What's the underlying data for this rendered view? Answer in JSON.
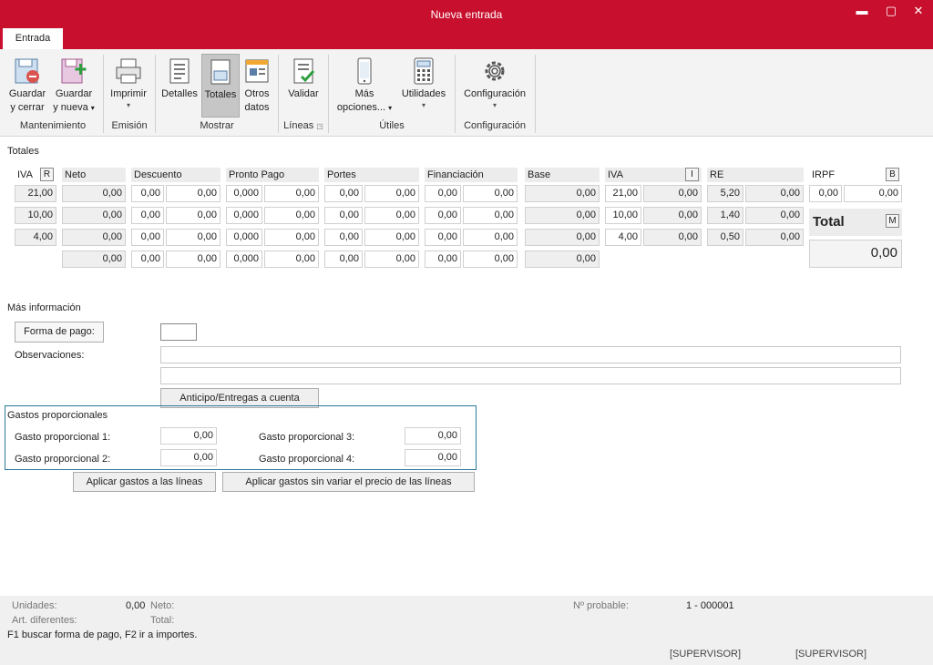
{
  "window": {
    "title": "Nueva entrada",
    "minimize": "▬",
    "maximize": "▢",
    "close": "✕",
    "tab": "Entrada"
  },
  "ribbon": {
    "guardar_cerrar": [
      "Guardar",
      "y cerrar"
    ],
    "guardar_nueva": [
      "Guardar",
      "y nueva"
    ],
    "imprimir": "Imprimir",
    "detalles": "Detalles",
    "totales": "Totales",
    "otros_datos": [
      "Otros",
      "datos"
    ],
    "validar": "Validar",
    "mas_opciones": [
      "Más",
      "opciones..."
    ],
    "utilidades": "Utilidades",
    "configuracion": "Configuración",
    "groups": {
      "mantenimiento": "Mantenimiento",
      "emision": "Emisión",
      "mostrar": "Mostrar",
      "lineas": "Líneas",
      "utiles": "Útiles",
      "configuracion": "Configuración"
    }
  },
  "totales": {
    "section_title": "Totales",
    "headers": {
      "iva": "IVA",
      "iva_badge": "R",
      "neto": "Neto",
      "descuento": "Descuento",
      "pronto_pago": "Pronto Pago",
      "portes": "Portes",
      "financiacion": "Financiación",
      "base": "Base",
      "iva2": "IVA",
      "iva2_badge": "I",
      "re": "RE",
      "irpf": "IRPF",
      "irpf_badge": "B"
    },
    "rows": [
      {
        "iva": "21,00",
        "neto": "0,00",
        "desc_pct": "0,00",
        "desc": "0,00",
        "pp_pct": "0,000",
        "pp": "0,00",
        "portes_pct": "0,00",
        "portes": "0,00",
        "fin_pct": "0,00",
        "fin": "0,00",
        "base": "0,00",
        "iva2_pct": "21,00",
        "iva2": "0,00",
        "re_pct": "5,20",
        "re": "0,00"
      },
      {
        "iva": "10,00",
        "neto": "0,00",
        "desc_pct": "0,00",
        "desc": "0,00",
        "pp_pct": "0,000",
        "pp": "0,00",
        "portes_pct": "0,00",
        "portes": "0,00",
        "fin_pct": "0,00",
        "fin": "0,00",
        "base": "0,00",
        "iva2_pct": "10,00",
        "iva2": "0,00",
        "re_pct": "1,40",
        "re": "0,00"
      },
      {
        "iva": "4,00",
        "neto": "0,00",
        "desc_pct": "0,00",
        "desc": "0,00",
        "pp_pct": "0,000",
        "pp": "0,00",
        "portes_pct": "0,00",
        "portes": "0,00",
        "fin_pct": "0,00",
        "fin": "0,00",
        "base": "0,00",
        "iva2_pct": "4,00",
        "iva2": "0,00",
        "re_pct": "0,50",
        "re": "0,00"
      }
    ],
    "totals_row": {
      "neto": "0,00",
      "desc_pct": "0,00",
      "desc": "0,00",
      "pp_pct": "0,000",
      "pp": "0,00",
      "portes_pct": "0,00",
      "portes": "0,00",
      "fin_pct": "0,00",
      "fin": "0,00",
      "base": "0,00"
    },
    "irpf": {
      "pct": "0,00",
      "value": "0,00"
    },
    "total_label": "Total",
    "total_badge": "M",
    "total_value": "0,00"
  },
  "mas_info": {
    "section_title": "Más información",
    "forma_pago_button": "Forma de pago:",
    "forma_pago_value": "",
    "observaciones_label": "Observaciones:",
    "anticipo_button": "Anticipo/Entregas a cuenta"
  },
  "gastos": {
    "title": "Gastos proporcionales",
    "g1_label": "Gasto proporcional 1:",
    "g1_value": "0,00",
    "g2_label": "Gasto proporcional 2:",
    "g2_value": "0,00",
    "g3_label": "Gasto proporcional 3:",
    "g3_value": "0,00",
    "g4_label": "Gasto proporcional 4:",
    "g4_value": "0,00",
    "aplicar_button": "Aplicar gastos a las líneas",
    "aplicar_sin_variar_button": "Aplicar gastos sin variar el precio de las líneas"
  },
  "status": {
    "unidades_label": "Unidades:",
    "unidades_value": "0,00",
    "neto_label": "Neto:",
    "art_label": "Art. diferentes:",
    "total_label": "Total:",
    "nprobable_label": "Nº probable:",
    "nprobable_value": "1 - 000001",
    "hint": "F1 buscar forma de pago, F2 ir a importes.",
    "user1": "[SUPERVISOR]",
    "user2": "[SUPERVISOR]"
  },
  "colors": {
    "brand": "#c8102e",
    "accent_border": "#2b7a9b"
  }
}
